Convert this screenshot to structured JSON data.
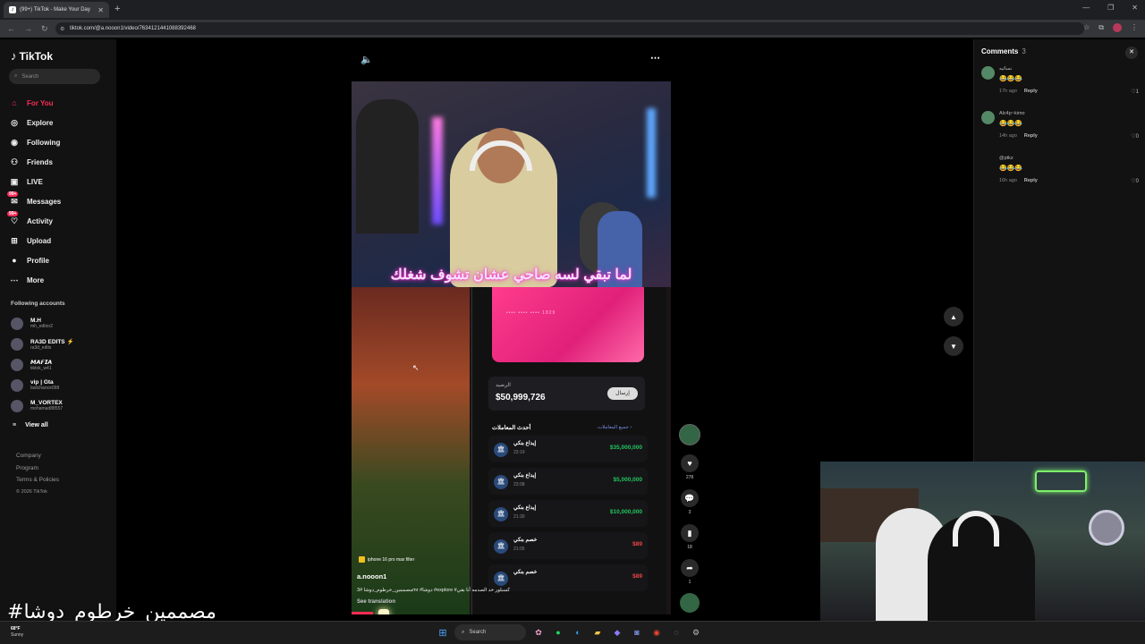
{
  "browser": {
    "tab_title": "(99+) TikTok - Make Your Day",
    "url": "tiktok.com/@a.nooon1/video/7634121441088392468"
  },
  "sidebar": {
    "logo": "TikTok",
    "search_placeholder": "Search",
    "nav": [
      {
        "label": "For You",
        "icon": "home-icon"
      },
      {
        "label": "Explore",
        "icon": "compass-icon"
      },
      {
        "label": "Following",
        "icon": "following-icon"
      },
      {
        "label": "Friends",
        "icon": "friends-icon"
      },
      {
        "label": "LIVE",
        "icon": "live-icon"
      },
      {
        "label": "Messages",
        "icon": "messages-icon",
        "badge": "99+"
      },
      {
        "label": "Activity",
        "icon": "activity-icon",
        "badge": "99+"
      },
      {
        "label": "Upload",
        "icon": "upload-icon"
      },
      {
        "label": "Profile",
        "icon": "profile-icon"
      },
      {
        "label": "More",
        "icon": "more-icon"
      }
    ],
    "following_header": "Following accounts",
    "accounts": [
      {
        "name": "M.H",
        "handle": "mh_editor2"
      },
      {
        "name": "RA3D EDITS ⚡",
        "handle": "ra3d_edits"
      },
      {
        "name": "𝙈𝘼𝙁𝙄𝘼",
        "handle": "tiktok_w41"
      },
      {
        "name": "vip | Gta",
        "handle": "lastchance098"
      },
      {
        "name": "M_VORTEX",
        "handle": "mohamad88557"
      }
    ],
    "view_all": "View all",
    "footer": {
      "company": "Company",
      "program": "Program",
      "terms": "Terms & Policies",
      "copyright": "© 2026 TikTok"
    }
  },
  "video": {
    "overlay_text": "لما تبقي لسه صاحي عشان تشوف شغلك",
    "effect": "iphone 16 pro max filter",
    "author": "a.nooon1",
    "caption": "مصممين_خرطوم_دوشا #3mr #دوشا #explore #كسبلور خد الصدمه أنا بقي",
    "see_translation": "See translation",
    "balance_label": "الرصيد",
    "balance": "$50,999,726",
    "send_label": "إرسال",
    "card_number": "•••• •••• •••• 1829",
    "transactions_header": "أحدث المعاملات",
    "transactions_all": "جميع المعاملات ›",
    "transactions": [
      {
        "name": "إيداع بنكي",
        "time": "23:19",
        "amount": "$35,000,000",
        "color": "#22c55e"
      },
      {
        "name": "إيداع بنكي",
        "time": "23:08",
        "amount": "$5,000,000",
        "color": "#22c55e"
      },
      {
        "name": "إيداع بنكي",
        "time": "21:30",
        "amount": "$10,000,000",
        "color": "#22c55e"
      },
      {
        "name": "خصم بنكي",
        "time": "21:05",
        "amount": "$89",
        "color": "#ef4444"
      },
      {
        "name": "خصم بنكي",
        "time": "",
        "amount": "$89",
        "color": "#ef4444"
      }
    ],
    "likes": "278",
    "comments": "3",
    "saves": "18",
    "shares": "1"
  },
  "comments_panel": {
    "title": "Comments",
    "count": "3",
    "items": [
      {
        "user": "نسائيه",
        "text": "😂😂😂",
        "time": "17h ago",
        "reply": "Reply",
        "likes": "1"
      },
      {
        "user": "Alc4p~kimo",
        "text": "😂😂😂",
        "time": "14h ago",
        "reply": "Reply",
        "likes": "0"
      },
      {
        "user": "@ptkz",
        "text": "😂😂😂",
        "time": "16h ago",
        "reply": "Reply",
        "likes": "0"
      }
    ]
  },
  "overlay_hashtag": "#مصممين_خرطوم_دوشا",
  "taskbar": {
    "temp": "68°F",
    "condition": "Sunny",
    "search": "Search"
  },
  "colors": {
    "accent": "#fe2c55",
    "deposit": "#22c55e",
    "withdraw": "#ef4444"
  }
}
